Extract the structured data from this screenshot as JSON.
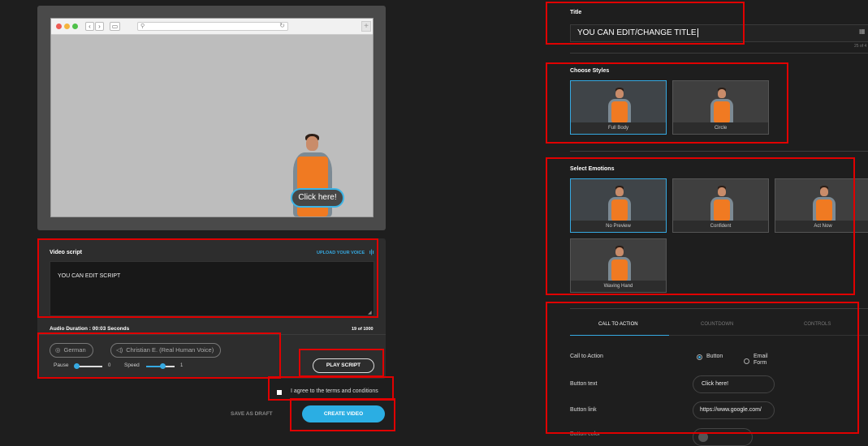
{
  "preview": {
    "cta_label": "Click here!"
  },
  "script": {
    "label": "Video script",
    "upload_label": "UPLOAD YOUR VOICE",
    "text": "YOU CAN EDIT SCRIPT",
    "duration": "Audio Duration : 00:03 Seconds",
    "char_count": "19 of 1000"
  },
  "voice": {
    "language": "German",
    "voice_name": "Christian E. (Real Human Voice)",
    "pause_label": "Pause",
    "pause_value": "0",
    "speed_label": "Speed",
    "speed_value": "1"
  },
  "actions": {
    "play_script": "PLAY SCRIPT",
    "terms": "I agree to the terms and conditions",
    "save_draft": "SAVE AS DRAFT",
    "create_video": "CREATE VIDEO"
  },
  "title_section": {
    "label": "Title",
    "value": "YOU CAN EDIT/CHANGE TITLE",
    "count": "25 of 4"
  },
  "styles": {
    "label": "Choose Styles",
    "items": [
      "Full Body",
      "Circle"
    ]
  },
  "emotions": {
    "label": "Select Emotions",
    "items": [
      "No Preview",
      "Confident",
      "Act Now",
      "Waving Hand"
    ]
  },
  "tabs": [
    "CALL TO ACTION",
    "COUNTDOWN",
    "CONTROLS"
  ],
  "cta_form": {
    "cta_label": "Call to Action",
    "option_button": "Button",
    "option_email": "Email Form",
    "button_text_label": "Button text",
    "button_text_value": "Click here!",
    "button_link_label": "Button link",
    "button_link_value": "https://www.google.com/",
    "button_color_label": "Button color"
  },
  "colors": {
    "accent": "#36a9e1",
    "highlight": "#e00000",
    "vest": "#f07a22"
  }
}
